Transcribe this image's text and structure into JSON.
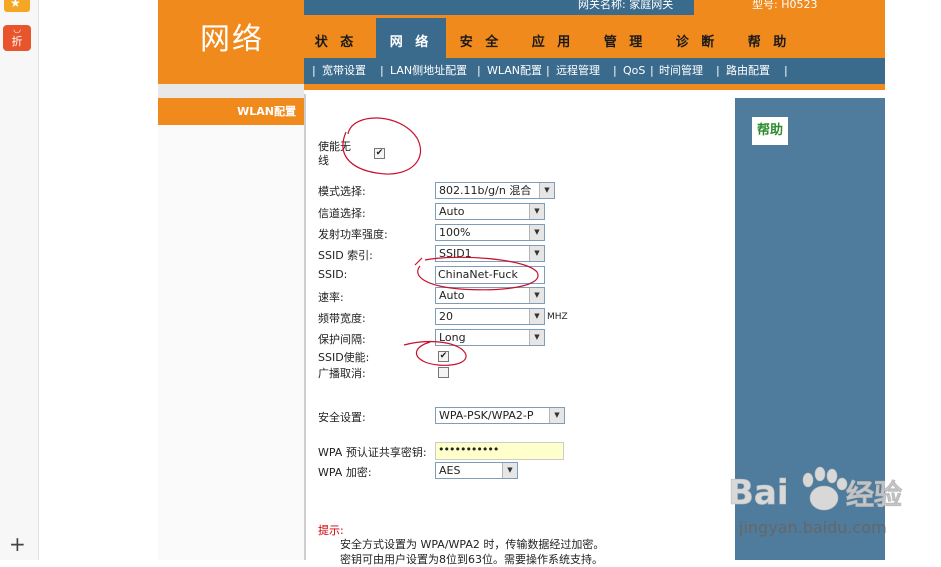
{
  "header": {
    "logo": "网络",
    "top_info_1": "网关名称: 家庭网关",
    "top_info_2": "型号: H0523"
  },
  "tabs": [
    {
      "label": "状 态",
      "active": false
    },
    {
      "label": "网 络",
      "active": true
    },
    {
      "label": "安 全",
      "active": false
    },
    {
      "label": "应 用",
      "active": false
    },
    {
      "label": "管 理",
      "active": false
    },
    {
      "label": "诊 断",
      "active": false
    },
    {
      "label": "帮 助",
      "active": false
    }
  ],
  "subnav": [
    "宽带设置",
    "LAN侧地址配置",
    "WLAN配置",
    "远程管理",
    "QoS",
    "时间管理",
    "路由配置"
  ],
  "subnav_sep": "|",
  "sidebar": {
    "item": "WLAN配置"
  },
  "help": {
    "label": "帮助"
  },
  "form": {
    "enable_wireless_label_1": "使能无",
    "enable_wireless_label_2": "线",
    "enable_wireless_checked": true,
    "mode_label": "模式选择:",
    "mode_value": "802.11b/g/n 混合",
    "channel_label": "信道选择:",
    "channel_value": "Auto",
    "power_label": "发射功率强度:",
    "power_value": "100%",
    "ssid_index_label": "SSID 索引:",
    "ssid_index_value": "SSID1",
    "ssid_label": "SSID:",
    "ssid_value": "ChinaNet-Fuck",
    "rate_label": "速率:",
    "rate_value": "Auto",
    "bandwidth_label": "频带宽度:",
    "bandwidth_value": "20",
    "bandwidth_unit": "MHZ",
    "guard_label": "保护间隔:",
    "guard_value": "Long",
    "ssid_enable_label": "SSID使能:",
    "ssid_enable_checked": true,
    "broadcast_cancel_label": "广播取消:",
    "broadcast_cancel_checked": false,
    "security_label": "安全设置:",
    "security_value": "WPA-PSK/WPA2-P",
    "wpa_key_label": "WPA 预认证共享密钥:",
    "wpa_key_value": "•••••••••••",
    "wpa_enc_label": "WPA 加密:",
    "wpa_enc_value": "AES"
  },
  "tip": {
    "title": "提示:",
    "line1": "安全方式设置为 WPA/WPA2 时，传输数据经过加密。",
    "line2": "密钥可由用户设置为8位到63位。需要操作系统支持。"
  },
  "browser": {
    "sale_label": "折",
    "plus": "+"
  },
  "watermark": {
    "brand": "Bai",
    "brand2": "经验",
    "url": "jingyan.baidu.com"
  },
  "colors": {
    "orange": "#f08a1c",
    "blue": "#3b6b8c",
    "annotation_red": "#c8102e"
  }
}
